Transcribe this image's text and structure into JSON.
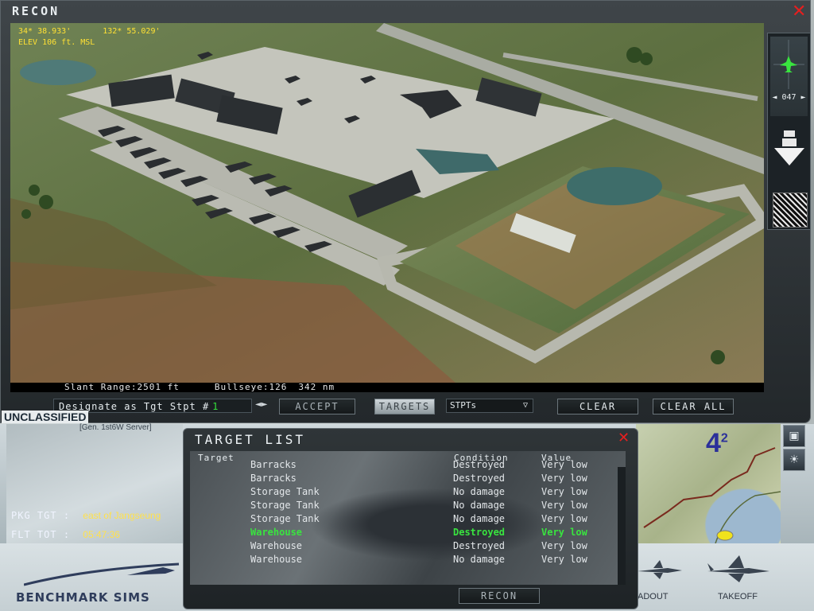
{
  "recon": {
    "title": "RECON",
    "lat": "34* 38.933'",
    "lon": "132* 55.029'",
    "elev": "ELEV 106 ft. MSL",
    "slant_range": "Slant Range:2501 ft",
    "bullseye": "Bullseye:126",
    "bullseye_dist": "342 nm",
    "heading": "047",
    "designate_label": "Designate as Tgt Stpt #",
    "stpt_number": "1",
    "accept_label": "ACCEPT",
    "targets_label": "TARGETS",
    "stpts_label": "STPTs",
    "clear_label": "CLEAR",
    "clear_all_label": "CLEAR ALL"
  },
  "target_list": {
    "title": "TARGET LIST",
    "columns": {
      "target": "Target",
      "condition": "Condition",
      "value": "Value"
    },
    "rows": [
      {
        "target": "Barracks",
        "condition": "Destroyed",
        "value": "Very low"
      },
      {
        "target": "Barracks",
        "condition": "Destroyed",
        "value": "Very low"
      },
      {
        "target": "Storage Tank",
        "condition": "No damage",
        "value": "Very low"
      },
      {
        "target": "Storage Tank",
        "condition": "No damage",
        "value": "Very low"
      },
      {
        "target": "Storage Tank",
        "condition": "No damage",
        "value": "Very low"
      },
      {
        "target": "Warehouse",
        "condition": "Destroyed",
        "value": "Very low"
      },
      {
        "target": "Warehouse",
        "condition": "Destroyed",
        "value": "Very low"
      },
      {
        "target": "Warehouse",
        "condition": "No damage",
        "value": "Very low"
      }
    ],
    "selected_index": 5,
    "recon_button": "RECON"
  },
  "background": {
    "unclassified": "UNCLASSIFIED",
    "server_note": "[Gen. 1st6W Server]",
    "pkg_tgt_label": "PKG TGT",
    "pkg_tgt_value": "east of Jangseung",
    "flt_tot_label": "FLT TOT",
    "flt_tot_value": "05:47:36",
    "map_number": "4",
    "map_sup": "2",
    "logo": "BENCHMARK SIMS",
    "loadout_label": "ADOUT",
    "takeoff_label": "TAKEOFF"
  },
  "colors": {
    "accent_green": "#39e43f",
    "coord_yellow": "#ffe034",
    "close_red": "#e51f1f"
  },
  "icons": [
    "close-icon",
    "compass-aircraft-icon",
    "down-arrow-icon",
    "recon-thumbnail-icon",
    "window-icon",
    "weather-icon",
    "dropdown-caret-icon"
  ]
}
